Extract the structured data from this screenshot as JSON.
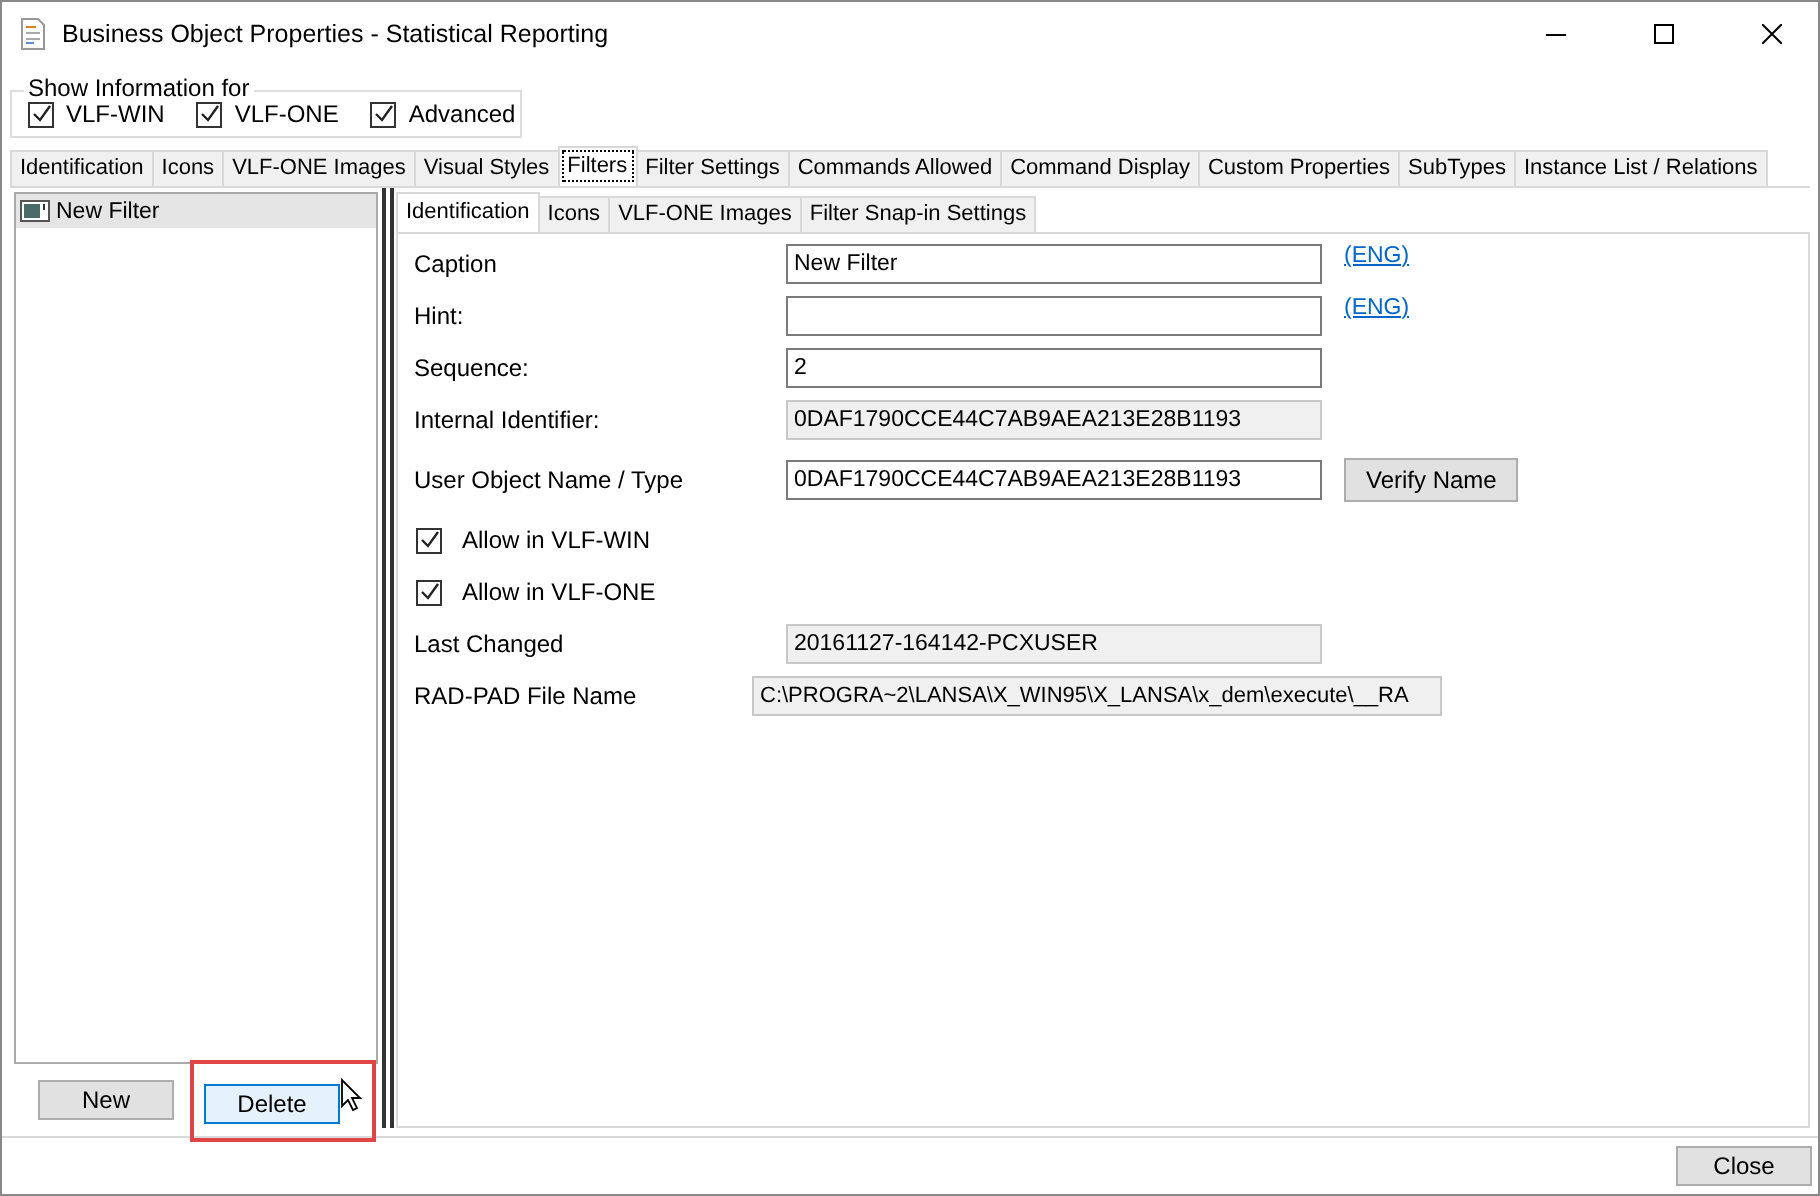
{
  "window": {
    "title": "Business Object Properties - Statistical Reporting"
  },
  "show_information": {
    "legend": "Show Information for",
    "options": [
      {
        "label": "VLF-WIN",
        "checked": true
      },
      {
        "label": "VLF-ONE",
        "checked": true
      },
      {
        "label": "Advanced",
        "checked": true
      }
    ]
  },
  "tabs": [
    {
      "label": "Identification",
      "selected": false
    },
    {
      "label": "Icons",
      "selected": false
    },
    {
      "label": "VLF-ONE Images",
      "selected": false
    },
    {
      "label": "Visual Styles",
      "selected": false
    },
    {
      "label": "Filters",
      "selected": true
    },
    {
      "label": "Filter Settings",
      "selected": false
    },
    {
      "label": "Commands Allowed",
      "selected": false
    },
    {
      "label": "Command Display",
      "selected": false
    },
    {
      "label": "Custom Properties",
      "selected": false
    },
    {
      "label": "SubTypes",
      "selected": false
    },
    {
      "label": "Instance List / Relations",
      "selected": false
    }
  ],
  "filter_list": {
    "items": [
      {
        "label": "New Filter",
        "selected": true
      }
    ]
  },
  "list_buttons": [
    {
      "label": "New",
      "hovered": false,
      "annotated": false
    },
    {
      "label": "Delete",
      "hovered": true,
      "annotated": true
    }
  ],
  "sub_tabs": [
    {
      "label": "Identification",
      "selected": true
    },
    {
      "label": "Icons",
      "selected": false
    },
    {
      "label": "VLF-ONE Images",
      "selected": false
    },
    {
      "label": "Filter Snap-in Settings",
      "selected": false
    }
  ],
  "form": [
    {
      "kind": "text",
      "label": "Caption",
      "value": "New Filter",
      "link": "(ENG)"
    },
    {
      "kind": "text",
      "label": "Hint:",
      "link": "(ENG)"
    },
    {
      "kind": "text",
      "label": "Sequence:",
      "value": "2"
    },
    {
      "kind": "readonly",
      "label": "Internal Identifier:",
      "value": "0DAF1790CCE44C7AB9AEA213E28B1193"
    },
    {
      "kind": "text",
      "label": "User Object Name / Type",
      "value": "0DAF1790CCE44C7AB9AEA213E28B1193",
      "button": "Verify Name"
    },
    {
      "kind": "checkbox",
      "label": "Allow in VLF-WIN",
      "checked": true
    },
    {
      "kind": "checkbox",
      "label": "Allow in VLF-ONE",
      "checked": true
    },
    {
      "kind": "readonly",
      "label": "Last Changed",
      "value": "20161127-164142-PCXUSER"
    },
    {
      "kind": "path",
      "label": "RAD-PAD File Name",
      "value": "C:\\PROGRA~2\\LANSA\\X_WIN95\\X_LANSA\\x_dem\\execute\\__RA"
    }
  ],
  "footer_buttons": [
    "Close"
  ]
}
